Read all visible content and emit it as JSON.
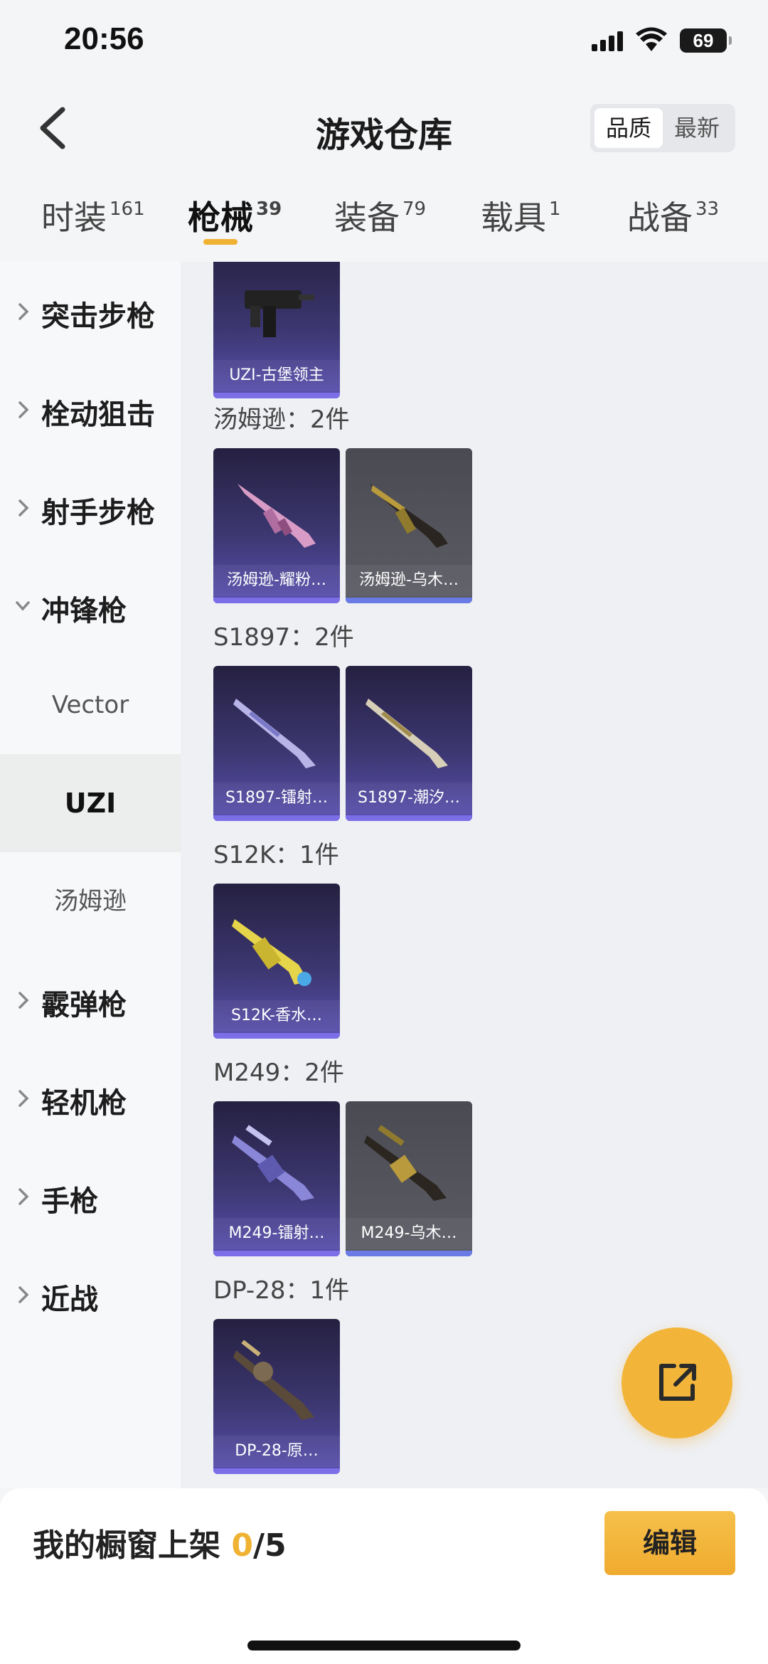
{
  "status_bar": {
    "time": "20:56",
    "battery": "69"
  },
  "header": {
    "title": "游戏仓库",
    "sort_options": [
      "品质",
      "最新"
    ]
  },
  "tabs": [
    {
      "label": "时装",
      "count": "161"
    },
    {
      "label": "枪械",
      "count": "39"
    },
    {
      "label": "装备",
      "count": "79"
    },
    {
      "label": "载具",
      "count": "1"
    },
    {
      "label": "战备",
      "count": "33"
    }
  ],
  "sidebar": {
    "categories": [
      "突击步枪",
      "栓动狙击",
      "射手步枪",
      "冲锋枪",
      "霰弹枪",
      "轻机枪",
      "手枪",
      "近战"
    ],
    "subitems": [
      "Vector",
      "UZI",
      "汤姆逊"
    ]
  },
  "groups": [
    {
      "title": "",
      "items": [
        "UZI-古堡领主"
      ]
    },
    {
      "title": "汤姆逊：2件",
      "items": [
        "汤姆逊-耀粉…",
        "汤姆逊-乌木…"
      ]
    },
    {
      "title": "S1897：2件",
      "items": [
        "S1897-镭射…",
        "S1897-潮汐…"
      ]
    },
    {
      "title": "S12K：1件",
      "items": [
        "S12K-香水…"
      ]
    },
    {
      "title": "M249：2件",
      "items": [
        "M249-镭射…",
        "M249-乌木…"
      ]
    },
    {
      "title": "DP-28：1件",
      "items": [
        "DP-28-原…"
      ]
    }
  ],
  "bottom": {
    "label": "我的橱窗上架",
    "count": "0",
    "total": "/5",
    "edit_label": "编辑"
  },
  "colors": {
    "accent": "#f0b232",
    "card_purple": "#3c3770",
    "card_gray": "#55555d"
  }
}
